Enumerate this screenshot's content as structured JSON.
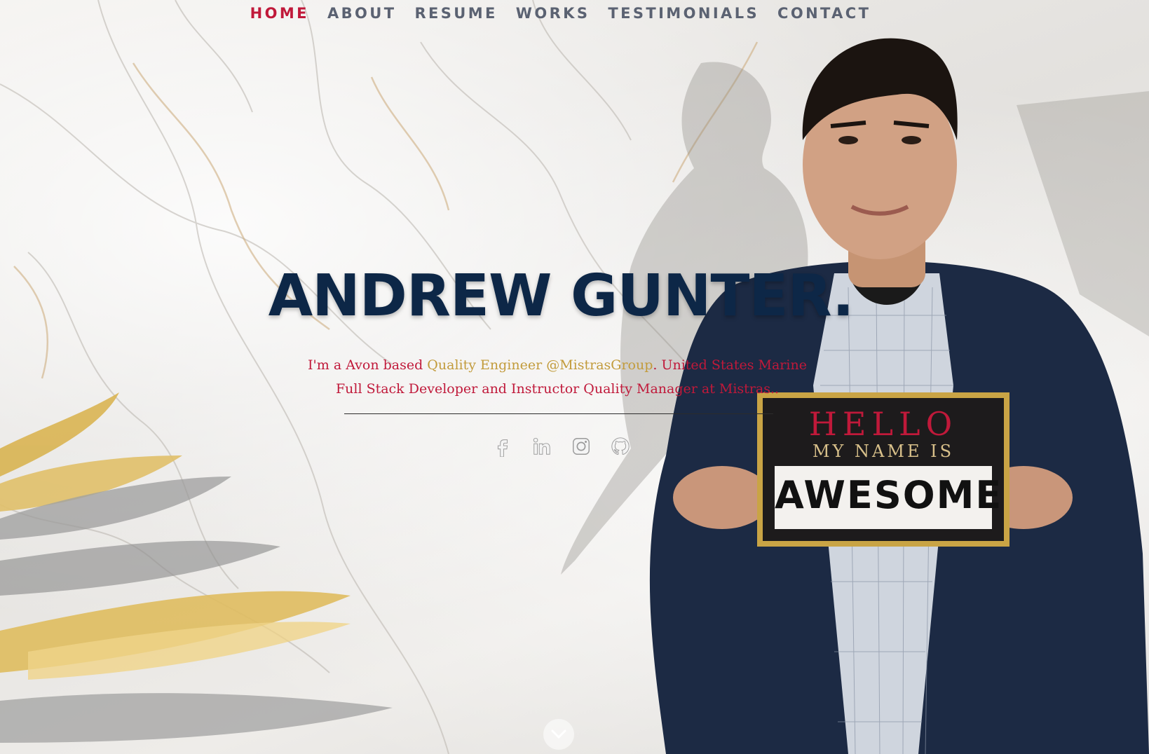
{
  "nav": {
    "items": [
      {
        "label": "HOME",
        "active": true
      },
      {
        "label": "ABOUT",
        "active": false
      },
      {
        "label": "RESUME",
        "active": false
      },
      {
        "label": "WORKS",
        "active": false
      },
      {
        "label": "TESTIMONIALS",
        "active": false
      },
      {
        "label": "CONTACT",
        "active": false
      }
    ]
  },
  "hero": {
    "title": "ANDREW GUNTER.",
    "tagline_prefix": "I'm a Avon based ",
    "tagline_highlight": "Quality Engineer @MistrasGroup",
    "tagline_suffix": ". United States Marine Full Stack Developer and Instructor Quality Manager at Mistras..",
    "sign_line1": "HELLO",
    "sign_line2": "MY NAME IS",
    "sign_line3": "AWESOME"
  },
  "social": [
    {
      "name": "facebook-icon"
    },
    {
      "name": "linkedin-icon"
    },
    {
      "name": "instagram-icon"
    },
    {
      "name": "github-icon"
    }
  ],
  "scroll_down": {
    "icon": "chevron-down-icon"
  },
  "colors": {
    "accent_red": "#c0193a",
    "nav_gray": "#5b6272",
    "title_navy": "#0d2747",
    "highlight_gold": "#c29b3b"
  }
}
